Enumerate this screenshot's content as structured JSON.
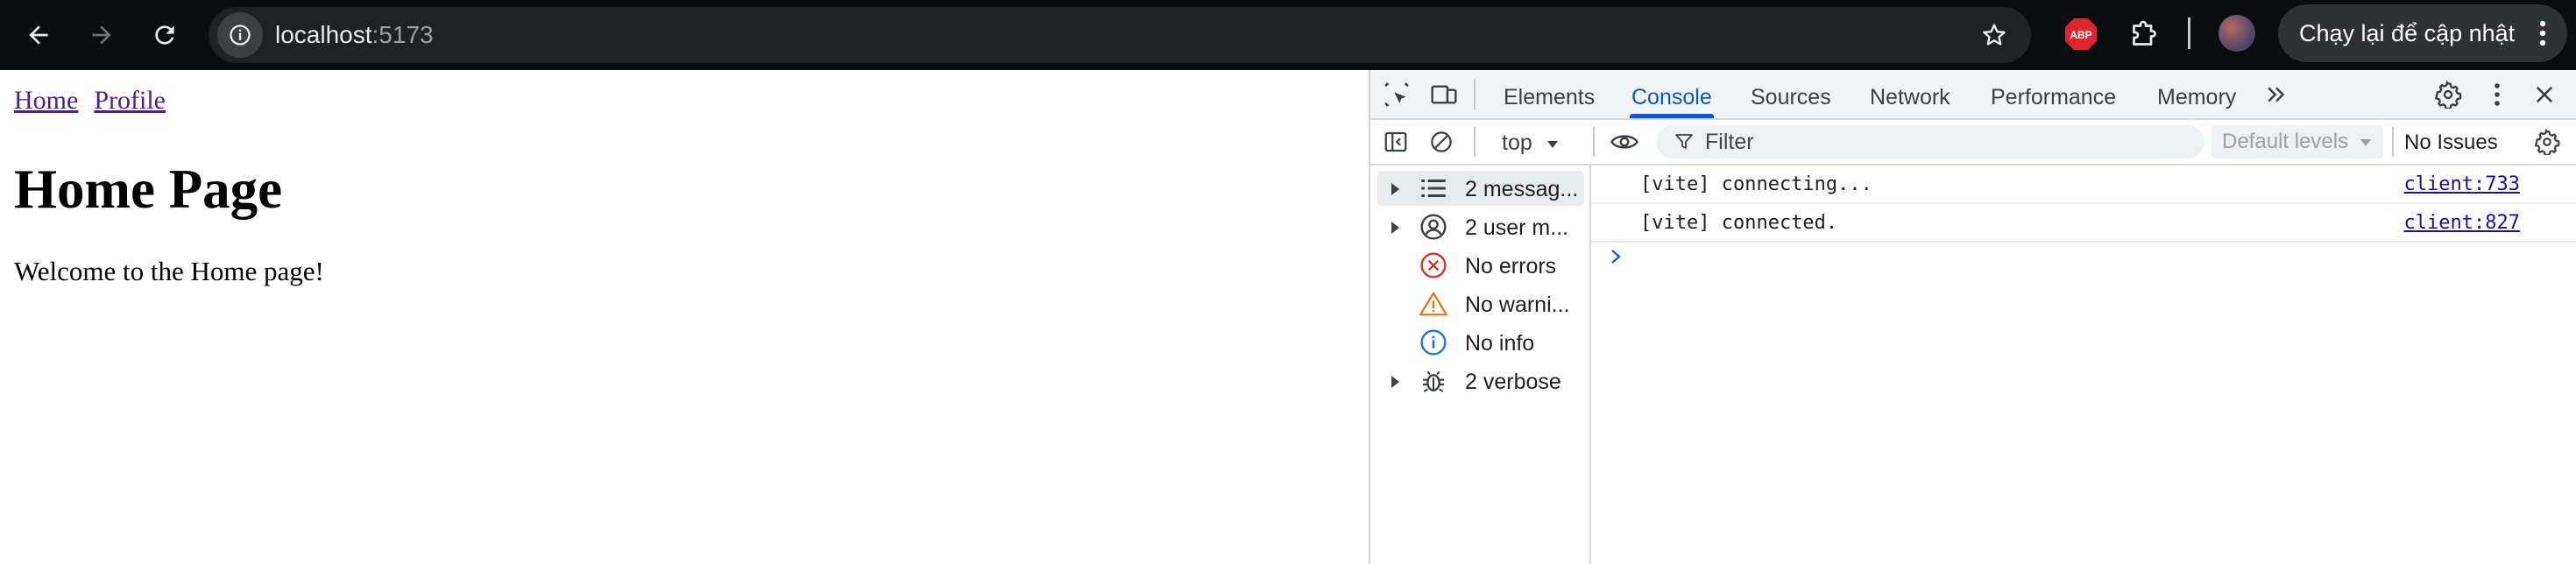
{
  "browser": {
    "url_host": "localhost",
    "url_port": ":5173",
    "update_button_label": "Chạy lại để cập nhật",
    "abp_label": "ABP"
  },
  "page": {
    "nav_links": [
      "Home",
      "Profile"
    ],
    "heading": "Home Page",
    "body_text": "Welcome to the Home page!"
  },
  "devtools": {
    "tabs": [
      "Elements",
      "Console",
      "Sources",
      "Network",
      "Performance",
      "Memory"
    ],
    "active_tab": "Console",
    "context": "top",
    "filter_placeholder": "Filter",
    "levels": "Default levels",
    "issues": "No Issues",
    "sidebar": [
      {
        "label": "2 messag...",
        "icon": "list-icon",
        "expandable": true,
        "selected": true
      },
      {
        "label": "2 user m...",
        "icon": "user-circle-icon",
        "expandable": true,
        "selected": false
      },
      {
        "label": "No errors",
        "icon": "error-icon",
        "expandable": false,
        "selected": false
      },
      {
        "label": "No warni...",
        "icon": "warning-icon",
        "expandable": false,
        "selected": false
      },
      {
        "label": "No info",
        "icon": "info-icon",
        "expandable": false,
        "selected": false
      },
      {
        "label": "2 verbose",
        "icon": "bug-icon",
        "expandable": true,
        "selected": false
      }
    ],
    "logs": [
      {
        "message": "[vite] connecting...",
        "source": "client:733"
      },
      {
        "message": "[vite] connected.",
        "source": "client:827"
      }
    ]
  },
  "colors": {
    "accent": "#0b57d0",
    "link_visited": "#551a8b",
    "error": "#d93025",
    "warning": "#e8710a",
    "info": "#1a73e8"
  }
}
